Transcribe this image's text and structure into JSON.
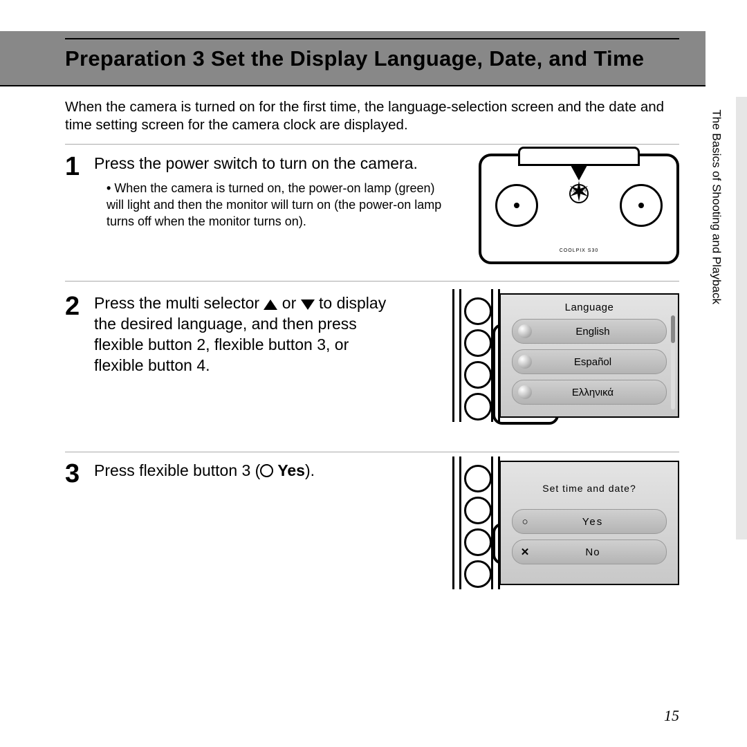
{
  "title": "Preparation 3 Set the Display Language, Date, and Time",
  "intro": "When the camera is turned on for the first time, the language-selection screen and the date and time setting screen for the camera clock are displayed.",
  "steps": {
    "s1": {
      "num": "1",
      "text": "Press the power switch to turn on the camera.",
      "bullet": "When the camera is turned on, the power-on lamp (green) will light and then the monitor will turn on (the power-on lamp turns off when the monitor turns on)."
    },
    "s2": {
      "num": "2",
      "before": "Press the multi selector ",
      "mid": " or ",
      "after": " to display the desired language, and then press flexible button 2, flexible button 3, or flexible button 4."
    },
    "s3": {
      "num": "3",
      "before": "Press flexible button 3 (",
      "yes": " Yes",
      "after": ")."
    }
  },
  "camera": {
    "power": "ON/\nOFF",
    "model": "COOLPIX S30"
  },
  "lang_screen": {
    "title": "Language",
    "opts": [
      "English",
      "Español",
      "Ελληνικά"
    ]
  },
  "time_screen": {
    "prompt": "Set time and date?",
    "yes": "Yes",
    "no": "No"
  },
  "side_label": "The Basics of Shooting and Playback",
  "page_number": "15"
}
